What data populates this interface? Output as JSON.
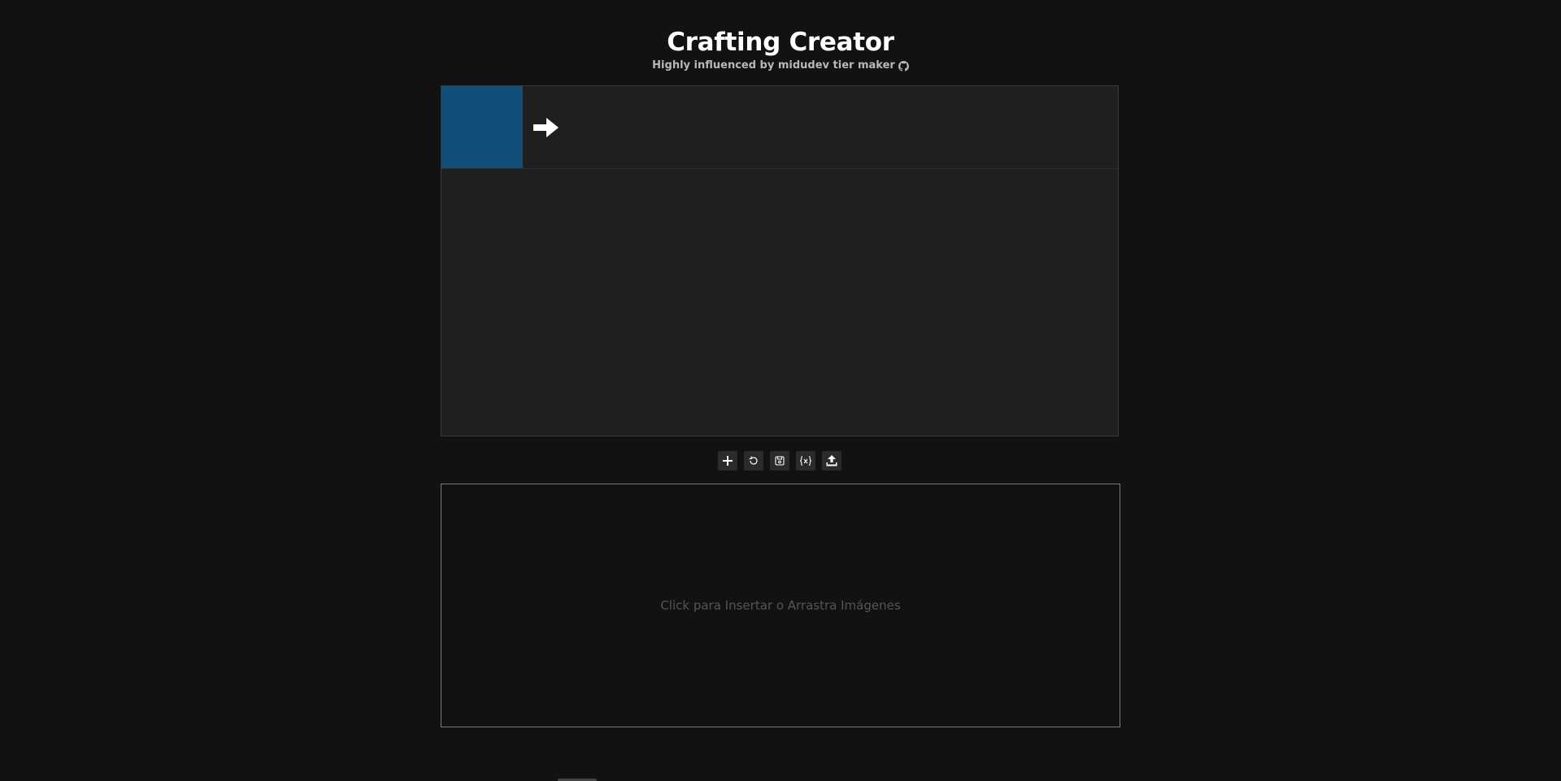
{
  "header": {
    "title": "Crafting Creator",
    "subtitle": "Highly influenced by midudev tier maker",
    "github_icon": "github-icon"
  },
  "board": {
    "row": {
      "label_color": "#124f78",
      "arrow_icon": "right-arrow-icon"
    }
  },
  "toolbar": {
    "buttons": [
      {
        "icon": "plus-icon",
        "title": "Add"
      },
      {
        "icon": "reset-icon",
        "title": "Reset"
      },
      {
        "icon": "save-icon",
        "title": "Save"
      },
      {
        "icon": "json-icon",
        "title": "JSON"
      },
      {
        "icon": "upload-icon",
        "title": "Upload"
      }
    ]
  },
  "dropzone": {
    "text": "Click para Insertar o Arrastra Imágenes"
  },
  "colors": {
    "background": "#121212",
    "panel": "#1f1f1f",
    "accent": "#124f78"
  }
}
